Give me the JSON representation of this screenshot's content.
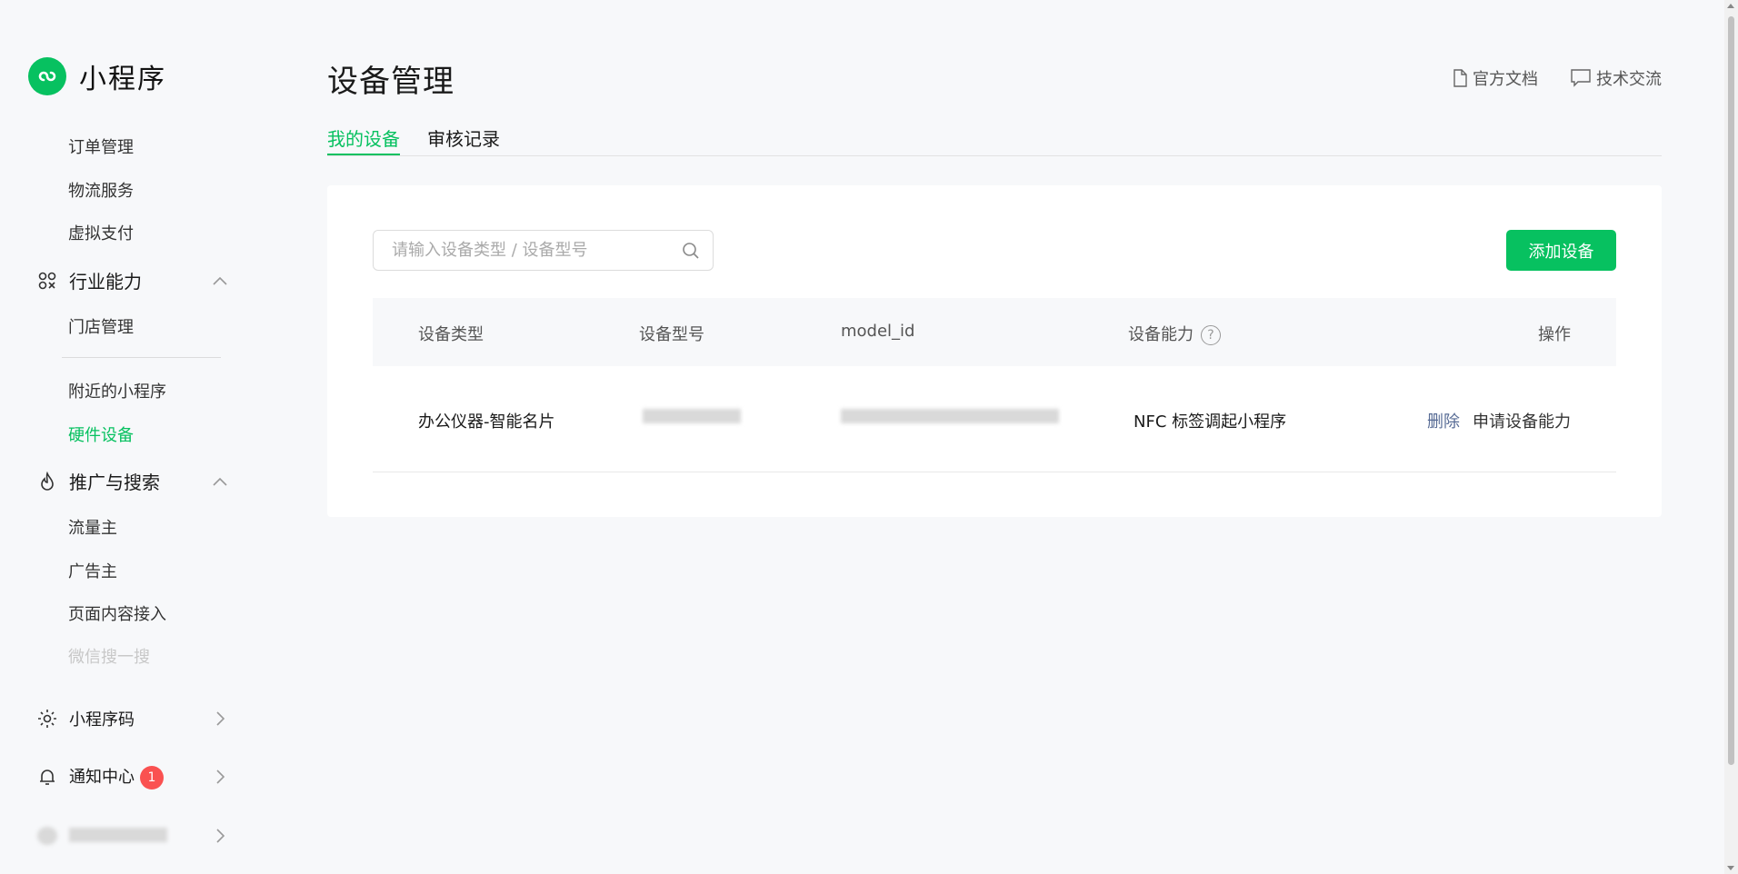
{
  "brand": {
    "name": "小程序",
    "icon": "miniprogram-logo-icon",
    "color": "#07c160"
  },
  "sidebar": {
    "items_top": [
      {
        "label": "订单管理"
      },
      {
        "label": "物流服务"
      },
      {
        "label": "虚拟支付"
      }
    ],
    "group_industry": {
      "label": "行业能力",
      "icon": "industry-icon",
      "expanded": true
    },
    "industry_items": [
      {
        "label": "门店管理"
      },
      {
        "label": "附近的小程序"
      },
      {
        "label": "硬件设备",
        "active": true
      }
    ],
    "group_promo": {
      "label": "推广与搜索",
      "icon": "flame-icon",
      "expanded": true
    },
    "promo_items": [
      {
        "label": "流量主"
      },
      {
        "label": "广告主"
      },
      {
        "label": "页面内容接入"
      },
      {
        "label": "微信搜一搜"
      }
    ],
    "group_code": {
      "label": "小程序码",
      "icon": "sun-icon"
    },
    "group_notify": {
      "label": "通知中心",
      "icon": "bell-icon",
      "badge": "1"
    },
    "account": {
      "icon": "avatar-icon"
    }
  },
  "header": {
    "title": "设备管理",
    "links": [
      {
        "label": "官方文档",
        "icon": "document-icon"
      },
      {
        "label": "技术交流",
        "icon": "chat-icon"
      }
    ]
  },
  "tabs": [
    {
      "label": "我的设备",
      "active": true
    },
    {
      "label": "审核记录",
      "active": false
    }
  ],
  "search": {
    "placeholder": "请输入设备类型 / 设备型号",
    "value": ""
  },
  "add_button": {
    "label": "添加设备"
  },
  "table": {
    "headers": [
      "设备类型",
      "设备型号",
      "model_id",
      "设备能力",
      "操作"
    ],
    "rows": [
      {
        "device_type": "办公仪器-智能名片",
        "device_model": "",
        "model_id": "",
        "capability": "NFC 标签调起小程序",
        "actions": [
          "删除",
          "申请设备能力"
        ]
      }
    ]
  },
  "colors": {
    "accent": "#07c160",
    "link": "#576b95",
    "badge": "#fa5151"
  }
}
